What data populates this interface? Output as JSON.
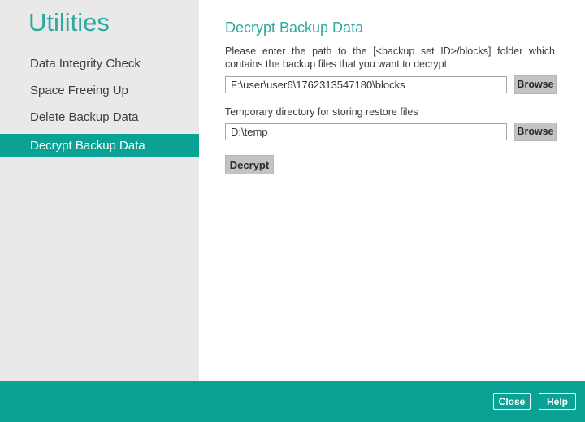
{
  "colors": {
    "accent_teal": "#0aa295",
    "heading_teal": "#2ea8a0",
    "sidebar_gray": "#e9e9e9",
    "button_gray": "#c3c3c3"
  },
  "sidebar": {
    "title": "Utilities",
    "items": [
      {
        "label": "Data Integrity Check",
        "selected": false
      },
      {
        "label": "Space Freeing Up",
        "selected": false
      },
      {
        "label": "Delete Backup Data",
        "selected": false
      },
      {
        "label": "Decrypt Backup Data",
        "selected": true
      }
    ]
  },
  "main": {
    "title": "Decrypt Backup Data",
    "description": "Please enter the path to the [<backup set ID>/blocks] folder which contains the backup files that you want to decrypt.",
    "backup_path": {
      "value": "F:\\user\\user6\\1762313547180\\blocks"
    },
    "temp_dir_label": "Temporary directory for storing restore files",
    "temp_dir": {
      "value": "D:\\temp"
    },
    "browse_label": "Browse",
    "decrypt_label": "Decrypt"
  },
  "footer": {
    "close_label": "Close",
    "help_label": "Help"
  }
}
